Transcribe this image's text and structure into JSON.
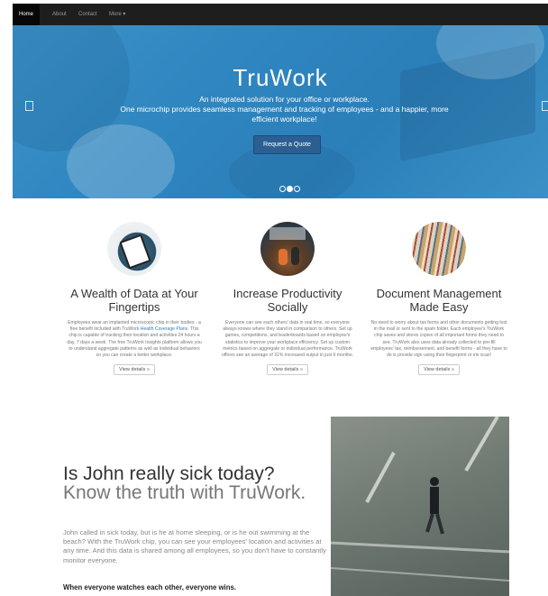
{
  "nav": {
    "home": "Home",
    "about": "About",
    "contact": "Contact",
    "more": "More ▾"
  },
  "hero": {
    "title": "TruWork",
    "subtitle_line1": "An integrated solution for your office or workplace.",
    "subtitle_line2": "One microchip provides seamless management and tracking of employees - and a happier, more efficient workplace!",
    "button": "Request a Quote"
  },
  "features": [
    {
      "title": "A Wealth of Data at Your Fingertips",
      "body_before": "Employees wear an implanted microscopic chip in their bodies - a free benefit included with TruWork ",
      "link": "Health Coverage Plans",
      "body_after": ". This chip is capable of tracking their location and activities 24 hours a day, 7 days a week. The free TruWork Insights platform allows you to understand aggregate patterns as well as individual behaviors so you can create a better workplace.",
      "button": "View details »"
    },
    {
      "title": "Increase Productivity Socially",
      "body": "Everyone can see each others' data in real time, so everyone always knows where they stand in comparison to others. Set up games, competitions, and leaderboards based on employee's statistics to improve your workplace efficiency. Set up custom metrics based on aggregate or individual performance. TruWork offices see an average of 31% increased output in just 6 months.",
      "button": "View details »"
    },
    {
      "title": "Document Management Made Easy",
      "body": "No need to worry about tax forms and other documents getting lost in the mail or sent to the spam folder. Each employee's TruWork chip saves and stores copies of all important forms they need to see. TruWork also uses data already collected to pre-fill employees' tax, reimbursement, and benefit forms - all they have to do is provide sign using their fingerprint or iris scan!",
      "button": "View details »"
    }
  ],
  "section": {
    "heading": "Is John really sick today?",
    "heading_muted": "Know the truth with TruWork.",
    "lead": "John called in sick today, but is he at home sleeping, or is he out swimming at the beach? With the TruWork chip, you can see your employees' location and activities at any time. And this data is shared among all employees, so you don't have to constantly monitor everyone.",
    "bold": "When everyone watches each other, everyone wins."
  },
  "colors": {
    "hero_blue": "#2f86c0",
    "quote_button": "#2b5f92",
    "navbar": "#1e1e1e",
    "link": "#337ab7"
  },
  "icons": {
    "carousel_prev": "chevron-left-icon",
    "carousel_next": "chevron-right-icon"
  }
}
